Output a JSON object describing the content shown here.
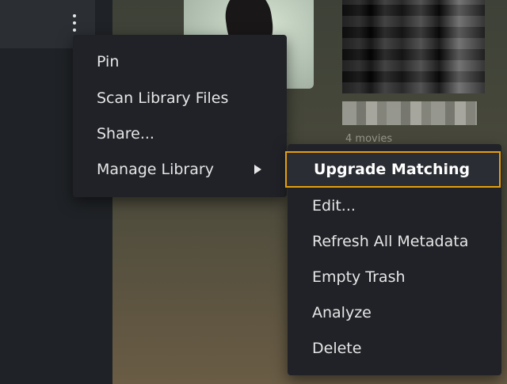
{
  "context_menu": {
    "items": [
      {
        "label": "Pin"
      },
      {
        "label": "Scan Library Files"
      },
      {
        "label": "Share..."
      },
      {
        "label": "Manage Library"
      }
    ]
  },
  "submenu": {
    "items": [
      {
        "label": "Upgrade Matching"
      },
      {
        "label": "Edit..."
      },
      {
        "label": "Refresh All Metadata"
      },
      {
        "label": "Empty Trash"
      },
      {
        "label": "Analyze"
      },
      {
        "label": "Delete"
      }
    ],
    "highlight_color": "#e5a00d"
  },
  "background": {
    "poster_caption": "4 movies"
  },
  "icons": {
    "more": "kebab-menu-icon",
    "submenu_arrow": "chevron-right-icon"
  }
}
